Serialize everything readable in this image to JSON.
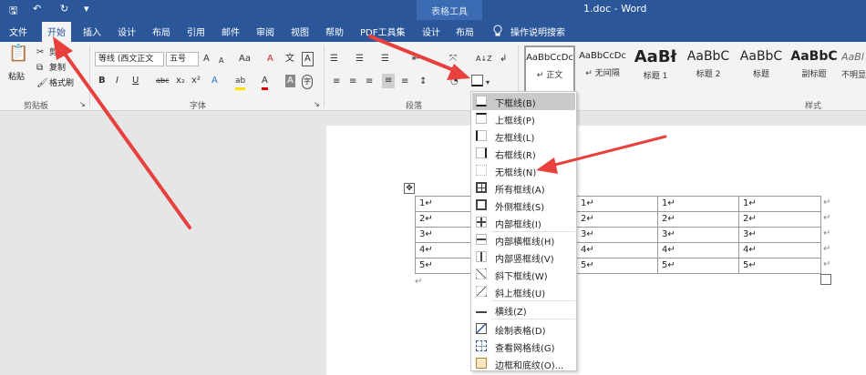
{
  "window": {
    "title": "1.doc - Word",
    "context_title": "表格工具"
  },
  "quick_access": {
    "save": "🖫",
    "undo": "↶",
    "redo": "↻",
    "customize": "▾"
  },
  "tabs": [
    "文件",
    "开始",
    "插入",
    "设计",
    "布局",
    "引用",
    "邮件",
    "审阅",
    "视图",
    "帮助",
    "PDF工具集",
    "设计",
    "布局"
  ],
  "tell_me": "操作说明搜索",
  "clipboard": {
    "paste": "粘贴",
    "cut": "剪切",
    "copy": "复制",
    "format_painter": "格式刷",
    "group": "剪贴板"
  },
  "font": {
    "name": "等线 (西文正文",
    "size": "五号",
    "group": "字体",
    "grow": "A",
    "shrink": "A",
    "case": "Aa",
    "clear": "A",
    "phonetic": "文",
    "border_char": "A",
    "bold": "B",
    "italic": "I",
    "underline": "U",
    "strike": "abc",
    "sub": "x₂",
    "sup": "x²",
    "effects": "A",
    "highlight": "ab",
    "color": "A",
    "shade": "A",
    "enclose": "字"
  },
  "paragraph": {
    "group": "段落",
    "sort": "A↓Z",
    "marks": "↲"
  },
  "styles": {
    "group": "样式",
    "items": [
      {
        "sample": "AaBbCcDc",
        "name": "↵ 正文"
      },
      {
        "sample": "AaBbCcDc",
        "name": "↵ 无间隔"
      },
      {
        "sample": "AaBł",
        "name": "标题 1"
      },
      {
        "sample": "AaBbC",
        "name": "标题 2"
      },
      {
        "sample": "AaBbC",
        "name": "标题"
      },
      {
        "sample": "AaBbC",
        "name": "副标题"
      },
      {
        "sample": "AaBl",
        "name": "不明显"
      }
    ]
  },
  "table": {
    "rows": [
      [
        "1↵",
        "1↵",
        "1↵",
        "1↵",
        "1↵"
      ],
      [
        "2↵",
        "2↵",
        "2↵",
        "2↵",
        "2↵"
      ],
      [
        "3↵",
        "3↵",
        "3↵",
        "3↵",
        "3↵"
      ],
      [
        "4↵",
        "4↵",
        "4↵",
        "4↵",
        "4↵"
      ],
      [
        "5↵",
        "5↵",
        "5↵",
        "5↵",
        "5↵"
      ]
    ],
    "end_marks": [
      "↵",
      "↵",
      "↵",
      "↵",
      "↵",
      "↵"
    ],
    "after": "↵",
    "move_handle": "✥"
  },
  "border_menu": {
    "items": [
      {
        "label": "下框线(B)",
        "icon": "bottom-border-icon"
      },
      {
        "label": "上框线(P)",
        "icon": "top-border-icon"
      },
      {
        "label": "左框线(L)",
        "icon": "left-border-icon"
      },
      {
        "label": "右框线(R)",
        "icon": "right-border-icon"
      },
      {
        "label": "无框线(N)",
        "icon": "no-border-icon"
      },
      {
        "label": "所有框线(A)",
        "icon": "all-borders-icon"
      },
      {
        "label": "外侧框线(S)",
        "icon": "outside-borders-icon"
      },
      {
        "label": "内部框线(I)",
        "icon": "inside-borders-icon"
      },
      {
        "label": "内部横框线(H)",
        "icon": "inside-horizontal-border-icon"
      },
      {
        "label": "内部竖框线(V)",
        "icon": "inside-vertical-border-icon"
      },
      {
        "label": "斜下框线(W)",
        "icon": "diagonal-down-border-icon"
      },
      {
        "label": "斜上框线(U)",
        "icon": "diagonal-up-border-icon"
      },
      {
        "label": "横线(Z)",
        "icon": "horizontal-line-icon"
      },
      {
        "label": "绘制表格(D)",
        "icon": "draw-table-icon"
      },
      {
        "label": "查看网格线(G)",
        "icon": "view-gridlines-icon"
      },
      {
        "label": "边框和底纹(O)...",
        "icon": "borders-shading-icon"
      }
    ]
  },
  "colors": {
    "titlebar": "#2b579a",
    "arrow": "#e8413d",
    "highlight": "#c9c9c9"
  }
}
